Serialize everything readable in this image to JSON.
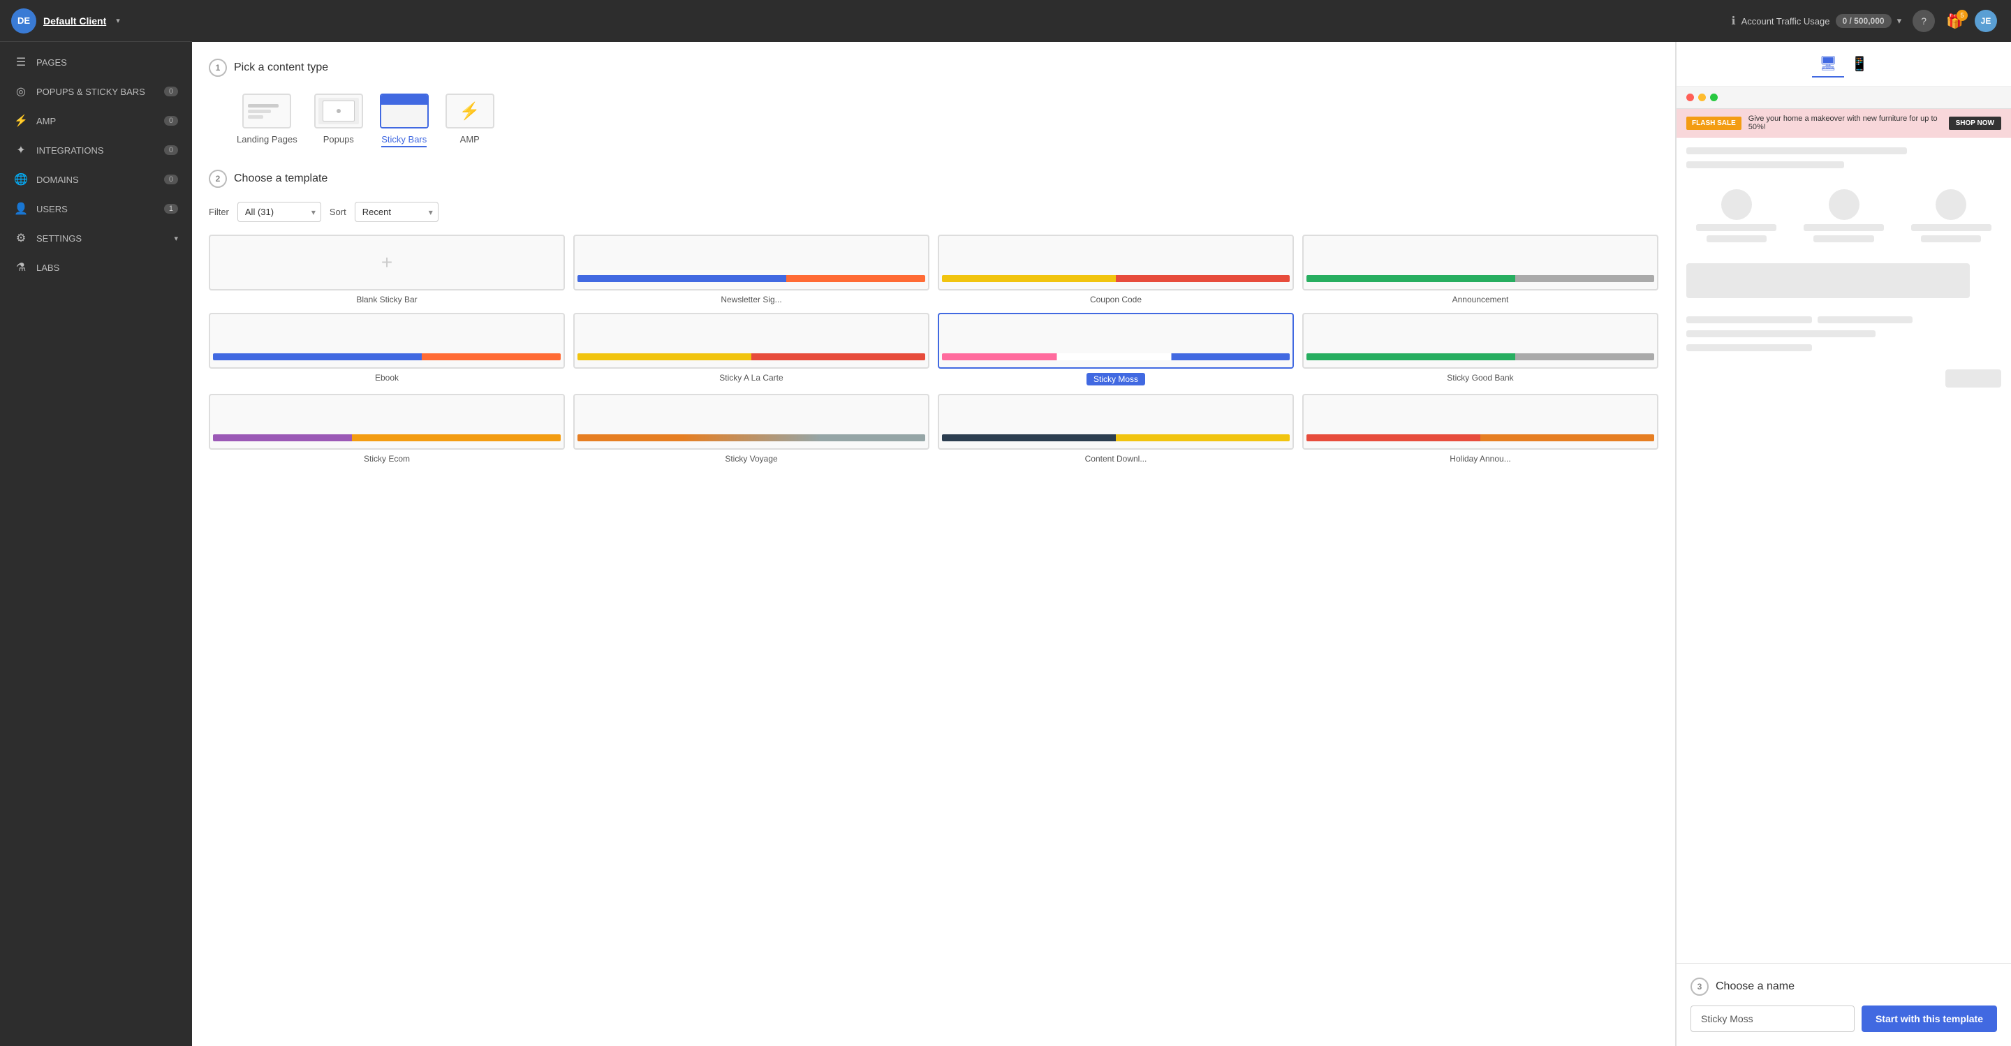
{
  "sidebar": {
    "client": {
      "initials": "DE",
      "name": "Default Client"
    },
    "items": [
      {
        "id": "pages",
        "label": "PAGES",
        "icon": "📄",
        "badge": null
      },
      {
        "id": "popups",
        "label": "POPUPS & STICKY BARS",
        "icon": "🎯",
        "badge": "0"
      },
      {
        "id": "amp",
        "label": "AMP",
        "icon": "⚡",
        "badge": "0"
      },
      {
        "id": "integrations",
        "label": "INTEGRATIONS",
        "icon": "🔗",
        "badge": "0"
      },
      {
        "id": "domains",
        "label": "DOMAINS",
        "icon": "🌐",
        "badge": "0"
      },
      {
        "id": "users",
        "label": "USERS",
        "icon": "👤",
        "badge": "1"
      },
      {
        "id": "settings",
        "label": "SETTINGS",
        "icon": "⚙️",
        "badge": null,
        "chevron": true
      },
      {
        "id": "labs",
        "label": "LABS",
        "icon": "🧪",
        "badge": null
      }
    ]
  },
  "topbar": {
    "traffic_label": "Account Traffic Usage",
    "traffic_value": "0 / 500,000",
    "user_initials": "JE"
  },
  "wizard": {
    "step1": {
      "number": "1",
      "title": "Pick a content type"
    },
    "content_types": [
      {
        "id": "landing-pages",
        "label": "Landing Pages",
        "active": false
      },
      {
        "id": "popups",
        "label": "Popups",
        "active": false
      },
      {
        "id": "sticky-bars",
        "label": "Sticky Bars",
        "active": true
      },
      {
        "id": "amp",
        "label": "AMP",
        "active": false
      }
    ],
    "step2": {
      "number": "2",
      "title": "Choose a template"
    },
    "filter": {
      "label": "Filter",
      "value": "All (31)"
    },
    "sort": {
      "label": "Sort",
      "value": "Recent"
    },
    "templates": [
      {
        "id": "blank",
        "label": "Blank Sticky Bar",
        "selected": false,
        "blank": true,
        "strip": ""
      },
      {
        "id": "newsletter",
        "label": "Newsletter Sig...",
        "selected": false,
        "blank": false,
        "strip": "strip-blue"
      },
      {
        "id": "coupon",
        "label": "Coupon Code",
        "selected": false,
        "blank": false,
        "strip": "strip-yellow-red"
      },
      {
        "id": "announcement",
        "label": "Announcement",
        "selected": false,
        "blank": false,
        "strip": "strip-green"
      },
      {
        "id": "ebook",
        "label": "Ebook",
        "selected": false,
        "blank": false,
        "strip": "strip-blue"
      },
      {
        "id": "sticky-a-la-carte",
        "label": "Sticky A La Carte",
        "selected": false,
        "blank": false,
        "strip": "strip-yellow-red"
      },
      {
        "id": "sticky-moss",
        "label": "Sticky Moss",
        "selected": true,
        "blank": false,
        "strip": "strip-pink-multi"
      },
      {
        "id": "sticky-good-bank",
        "label": "Sticky Good Bank",
        "selected": false,
        "blank": false,
        "strip": "strip-green"
      },
      {
        "id": "sticky-ecom",
        "label": "Sticky Ecom",
        "selected": false,
        "blank": false,
        "strip": "strip-purple"
      },
      {
        "id": "sticky-voyage",
        "label": "Sticky Voyage",
        "selected": false,
        "blank": false,
        "strip": "strip-orange-gray"
      },
      {
        "id": "content-downl",
        "label": "Content Downl...",
        "selected": false,
        "blank": false,
        "strip": "strip-dark-yellow"
      },
      {
        "id": "holiday-annou",
        "label": "Holiday Annou...",
        "selected": false,
        "blank": false,
        "strip": "strip-red-orange"
      }
    ]
  },
  "preview": {
    "devices": [
      {
        "id": "desktop",
        "icon": "🖥",
        "active": true
      },
      {
        "id": "mobile",
        "icon": "📱",
        "active": false
      }
    ],
    "sticky_bar": {
      "badge": "FLASH SALE",
      "text": "Give your home a makeover with new furniture for up to 50%!",
      "cta": "SHOP NOW"
    }
  },
  "choose_name": {
    "step": {
      "number": "3",
      "title": "Choose a name"
    },
    "placeholder": "Sticky Moss",
    "button_label": "Start with this template"
  }
}
